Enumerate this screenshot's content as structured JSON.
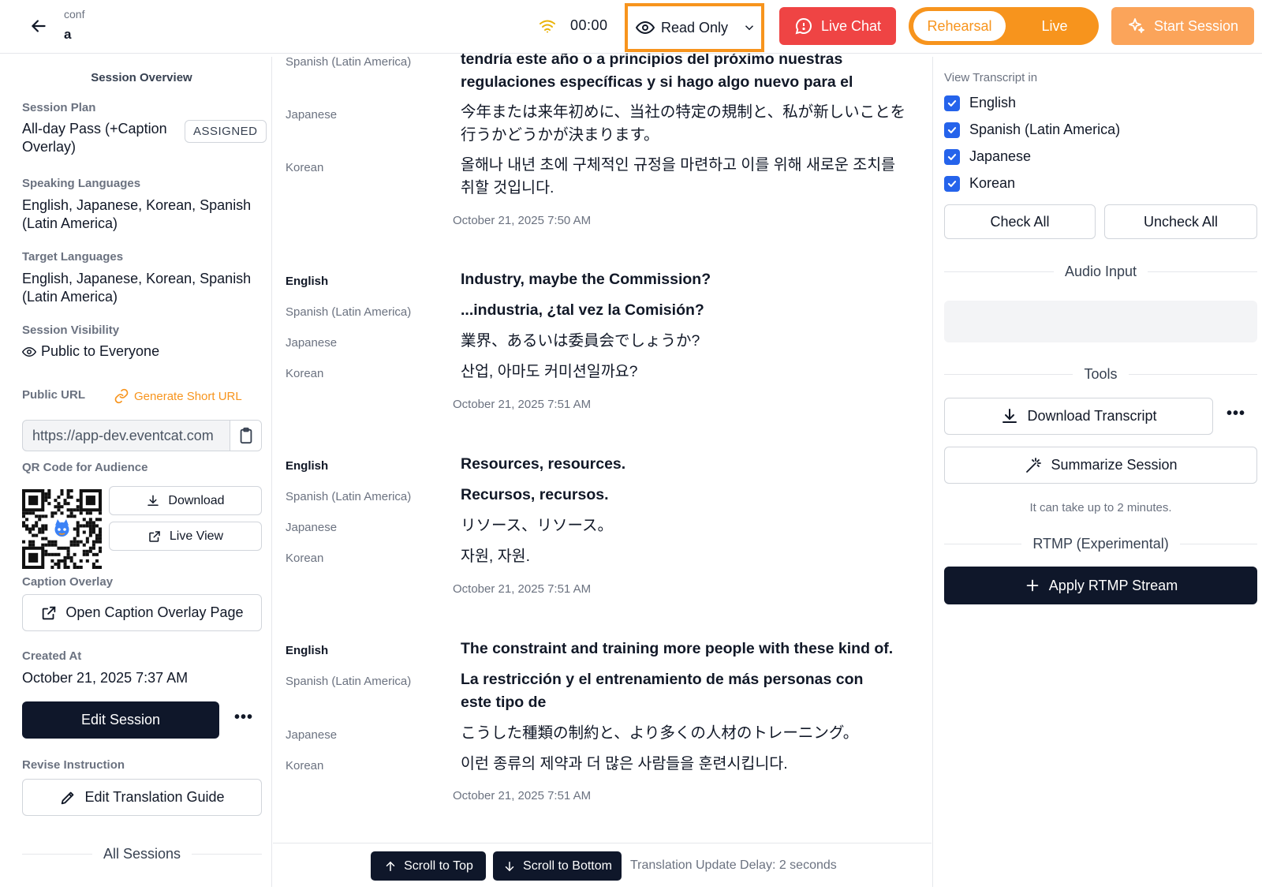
{
  "header": {
    "crumb": "conf",
    "conf_name": "a",
    "timer": "00:00",
    "view_mode": "Read Only",
    "live_chat": "Live Chat",
    "mode_rehearsal": "Rehearsal",
    "mode_live": "Live",
    "start_session": "Start Session"
  },
  "colors": {
    "accent": "#f7941d",
    "danger": "#ef4444",
    "dark": "#0f172a",
    "check": "#2563eb"
  },
  "left": {
    "overview_title": "Session Overview",
    "plan_label": "Session Plan",
    "plan_value_1": "All-day Pass (+Caption",
    "plan_value_2": "Overlay)",
    "plan_badge": "ASSIGNED",
    "speaking_label": "Speaking Languages",
    "speaking_value_1": "English, Japanese, Korean, Spanish",
    "speaking_value_2": "(Latin America)",
    "target_label": "Target Languages",
    "target_value_1": "English, Japanese, Korean, Spanish",
    "target_value_2": "(Latin America)",
    "visibility_label": "Session Visibility",
    "visibility_value": "Public to Everyone",
    "url_label": "Public URL",
    "generate_short_url": "Generate Short URL",
    "url_value": "https://app-dev.eventcat.com",
    "qr_label": "QR Code for Audience",
    "download": "Download",
    "live_view": "Live View",
    "caption_label": "Caption Overlay",
    "open_caption": "Open Caption Overlay Page",
    "created_label": "Created At",
    "created_value": "October 21, 2025 7:37 AM",
    "edit_session": "Edit Session",
    "revise_label": "Revise Instruction",
    "edit_guide": "Edit Translation Guide",
    "all_sessions": "All Sessions"
  },
  "transcript": {
    "top_partial": {
      "lang1": "Spanish (Latin America)",
      "text1_a": "tendría este año o a principios del próximo nuestras",
      "text1_b": "regulaciones específicas y si hago algo nuevo para el",
      "lang2": "Japanese",
      "text2_a": "今年または来年初めに、当社の特定の規制と、私が新しいことを",
      "text2_b": "行うかどうかが決まります。",
      "lang3": "Korean",
      "text3_a": "올해나 내년 초에 구체적인 규정을 마련하고 이를 위해 새로운 조치를",
      "text3_b": "취할 것입니다.",
      "time": "October 21, 2025 7:50 AM"
    },
    "blocks": [
      {
        "en_lang": "English",
        "en": "Industry, maybe the Commission?",
        "es_lang": "Spanish (Latin America)",
        "es": "...industria, ¿tal vez la Comisión?",
        "ja_lang": "Japanese",
        "ja": "業界、あるいは委員会でしょうか?",
        "ko_lang": "Korean",
        "ko": "산업, 아마도 커미션일까요?",
        "time": "October 21, 2025 7:51 AM"
      },
      {
        "en_lang": "English",
        "en": "Resources, resources.",
        "es_lang": "Spanish (Latin America)",
        "es": "Recursos, recursos.",
        "ja_lang": "Japanese",
        "ja": "リソース、リソース。",
        "ko_lang": "Korean",
        "ko": "자원, 자원.",
        "time": "October 21, 2025 7:51 AM"
      },
      {
        "en_lang": "English",
        "en": "The constraint and training more people with these kind of.",
        "es_lang": "Spanish (Latin America)",
        "es_a": "La restricción y el entrenamiento de más personas con",
        "es_b": "este tipo de",
        "ja_lang": "Japanese",
        "ja": "こうした種類の制約と、より多くの人材のトレーニング。",
        "ko_lang": "Korean",
        "ko": "이런 종류의 제약과 더 많은 사람들을 훈련시킵니다.",
        "time": "October 21, 2025 7:51 AM"
      }
    ],
    "scroll_top": "Scroll to Top",
    "scroll_bottom": "Scroll to Bottom",
    "delay": "Translation Update Delay: 2 seconds"
  },
  "right": {
    "view_label": "View Transcript in",
    "languages": [
      "English",
      "Spanish (Latin America)",
      "Japanese",
      "Korean"
    ],
    "check_all": "Check All",
    "uncheck_all": "Uncheck All",
    "audio_title": "Audio Input",
    "tools_title": "Tools",
    "download_transcript": "Download Transcript",
    "summarize": "Summarize Session",
    "summarize_hint": "It can take up to 2 minutes.",
    "rtmp_title": "RTMP (Experimental)",
    "apply_rtmp": "Apply RTMP Stream"
  }
}
